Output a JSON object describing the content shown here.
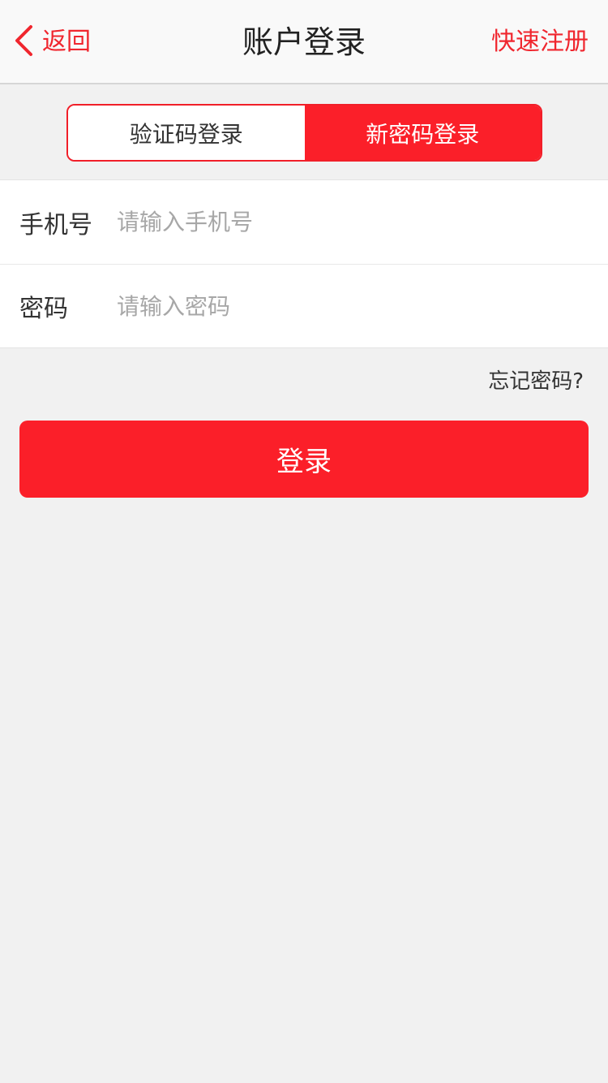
{
  "header": {
    "back_label": "返回",
    "title": "账户登录",
    "register_label": "快速注册"
  },
  "tabs": [
    {
      "label": "验证码登录",
      "active": false
    },
    {
      "label": "新密码登录",
      "active": true
    }
  ],
  "form": {
    "phone": {
      "label": "手机号",
      "placeholder": "请输入手机号",
      "value": ""
    },
    "password": {
      "label": "密码",
      "placeholder": "请输入密码",
      "value": ""
    }
  },
  "forgot_label": "忘记密码?",
  "login_label": "登录",
  "colors": {
    "accent": "#fb1f29",
    "background": "#f1f1f1"
  },
  "icons": {
    "back": "chevron-left-icon"
  }
}
